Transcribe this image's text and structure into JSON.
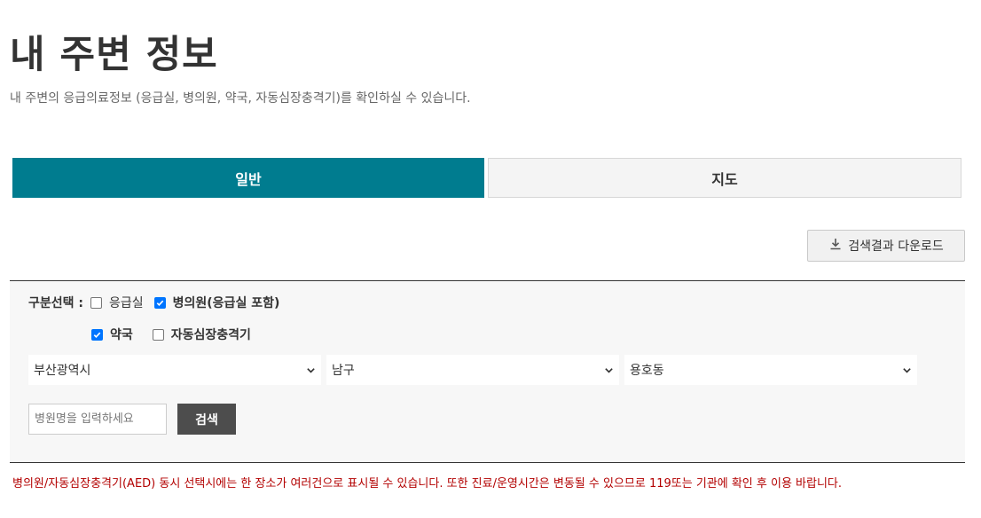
{
  "header": {
    "title": "내 주변 정보",
    "description": "내 주변의 응급의료정보 (응급실, 병의원, 약국, 자동심장충격기)를 확인하실 수 있습니다."
  },
  "tabs": [
    {
      "label": "일반",
      "active": true
    },
    {
      "label": "지도",
      "active": false
    }
  ],
  "download": {
    "label": "검색결과 다운로드",
    "icon": "download-icon"
  },
  "filter": {
    "label": "구분선택 :",
    "options": [
      {
        "label": "응급실",
        "checked": false
      },
      {
        "label": "병의원(응급실 포함)",
        "checked": true
      },
      {
        "label": "약국",
        "checked": true
      },
      {
        "label": "자동심장충격기",
        "checked": false
      }
    ]
  },
  "selects": {
    "city": "부산광역시",
    "district": "남구",
    "dong": "용호동"
  },
  "search": {
    "placeholder": "병원명을 입력하세요",
    "button_label": "검색"
  },
  "notice": "병의원/자동심장충격기(AED) 동시 선택시에는 한 장소가 여러건으로 표시될 수 있습니다. 또한 진료/운영시간은 변동될 수 있으므로 119또는 기관에 확인 후 이용 바랍니다.",
  "colors": {
    "accent": "#007c8f",
    "notice": "#b30000",
    "checkbox_checked": "#0075ff",
    "search_button": "#4d4d4d"
  }
}
